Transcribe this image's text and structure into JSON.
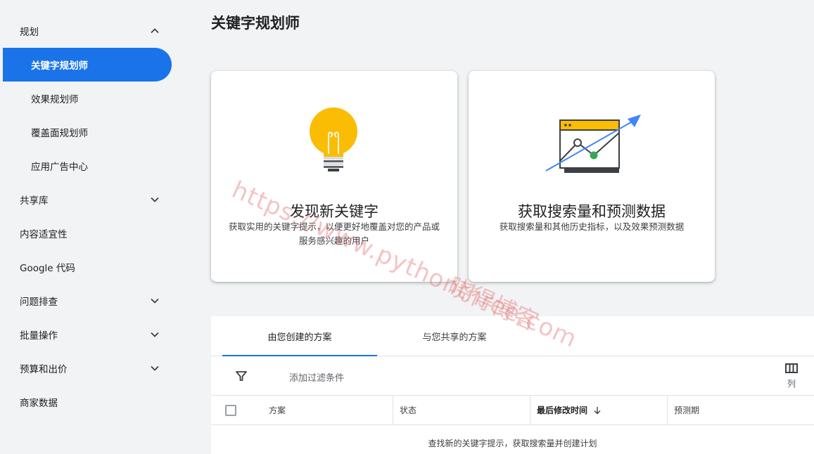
{
  "sidebar": {
    "sections": [
      {
        "label": "规划",
        "chevron": "up"
      },
      {
        "label": "共享库",
        "chevron": "down"
      },
      {
        "label": "内容适宜性"
      },
      {
        "label": "Google 代码"
      },
      {
        "label": "问题排查",
        "chevron": "down"
      },
      {
        "label": "批量操作",
        "chevron": "down"
      },
      {
        "label": "预算和出价",
        "chevron": "down"
      },
      {
        "label": "商家数据"
      }
    ],
    "planning_items": [
      {
        "label": "关键字规划师",
        "active": true
      },
      {
        "label": "效果规划师"
      },
      {
        "label": "覆盖面规划师"
      },
      {
        "label": "应用广告中心"
      }
    ]
  },
  "page_title": "关键字规划师",
  "cards": [
    {
      "title": "发现新关键字",
      "desc": "获取实用的关键字提示，以便更好地覆盖对您的产品或服务感兴趣的用户",
      "illustration": "lightbulb-icon"
    },
    {
      "title": "获取搜索量和预测数据",
      "desc": "获取搜索量和其他历史指标，以及效果预测数据",
      "illustration": "trend-chart-icon"
    }
  ],
  "watermark": {
    "line1": "https://www.pythonthree.com",
    "line2": "晓得博客"
  },
  "plans": {
    "tabs": [
      "由您创建的方案",
      "与您共享的方案"
    ],
    "active_tab": 0,
    "filter_placeholder": "添加过滤条件",
    "columns_label": "列",
    "headers": [
      "方案",
      "状态",
      "最后修改时间",
      "预测期"
    ],
    "sort_column": "最后修改时间",
    "empty_message": "查找新的关键字提示，获取搜索量并创建计划"
  },
  "colors": {
    "accent": "#1a73e8",
    "bulb": "#fbbc04",
    "green_dot": "#34a853",
    "arrow": "#4285f4"
  }
}
